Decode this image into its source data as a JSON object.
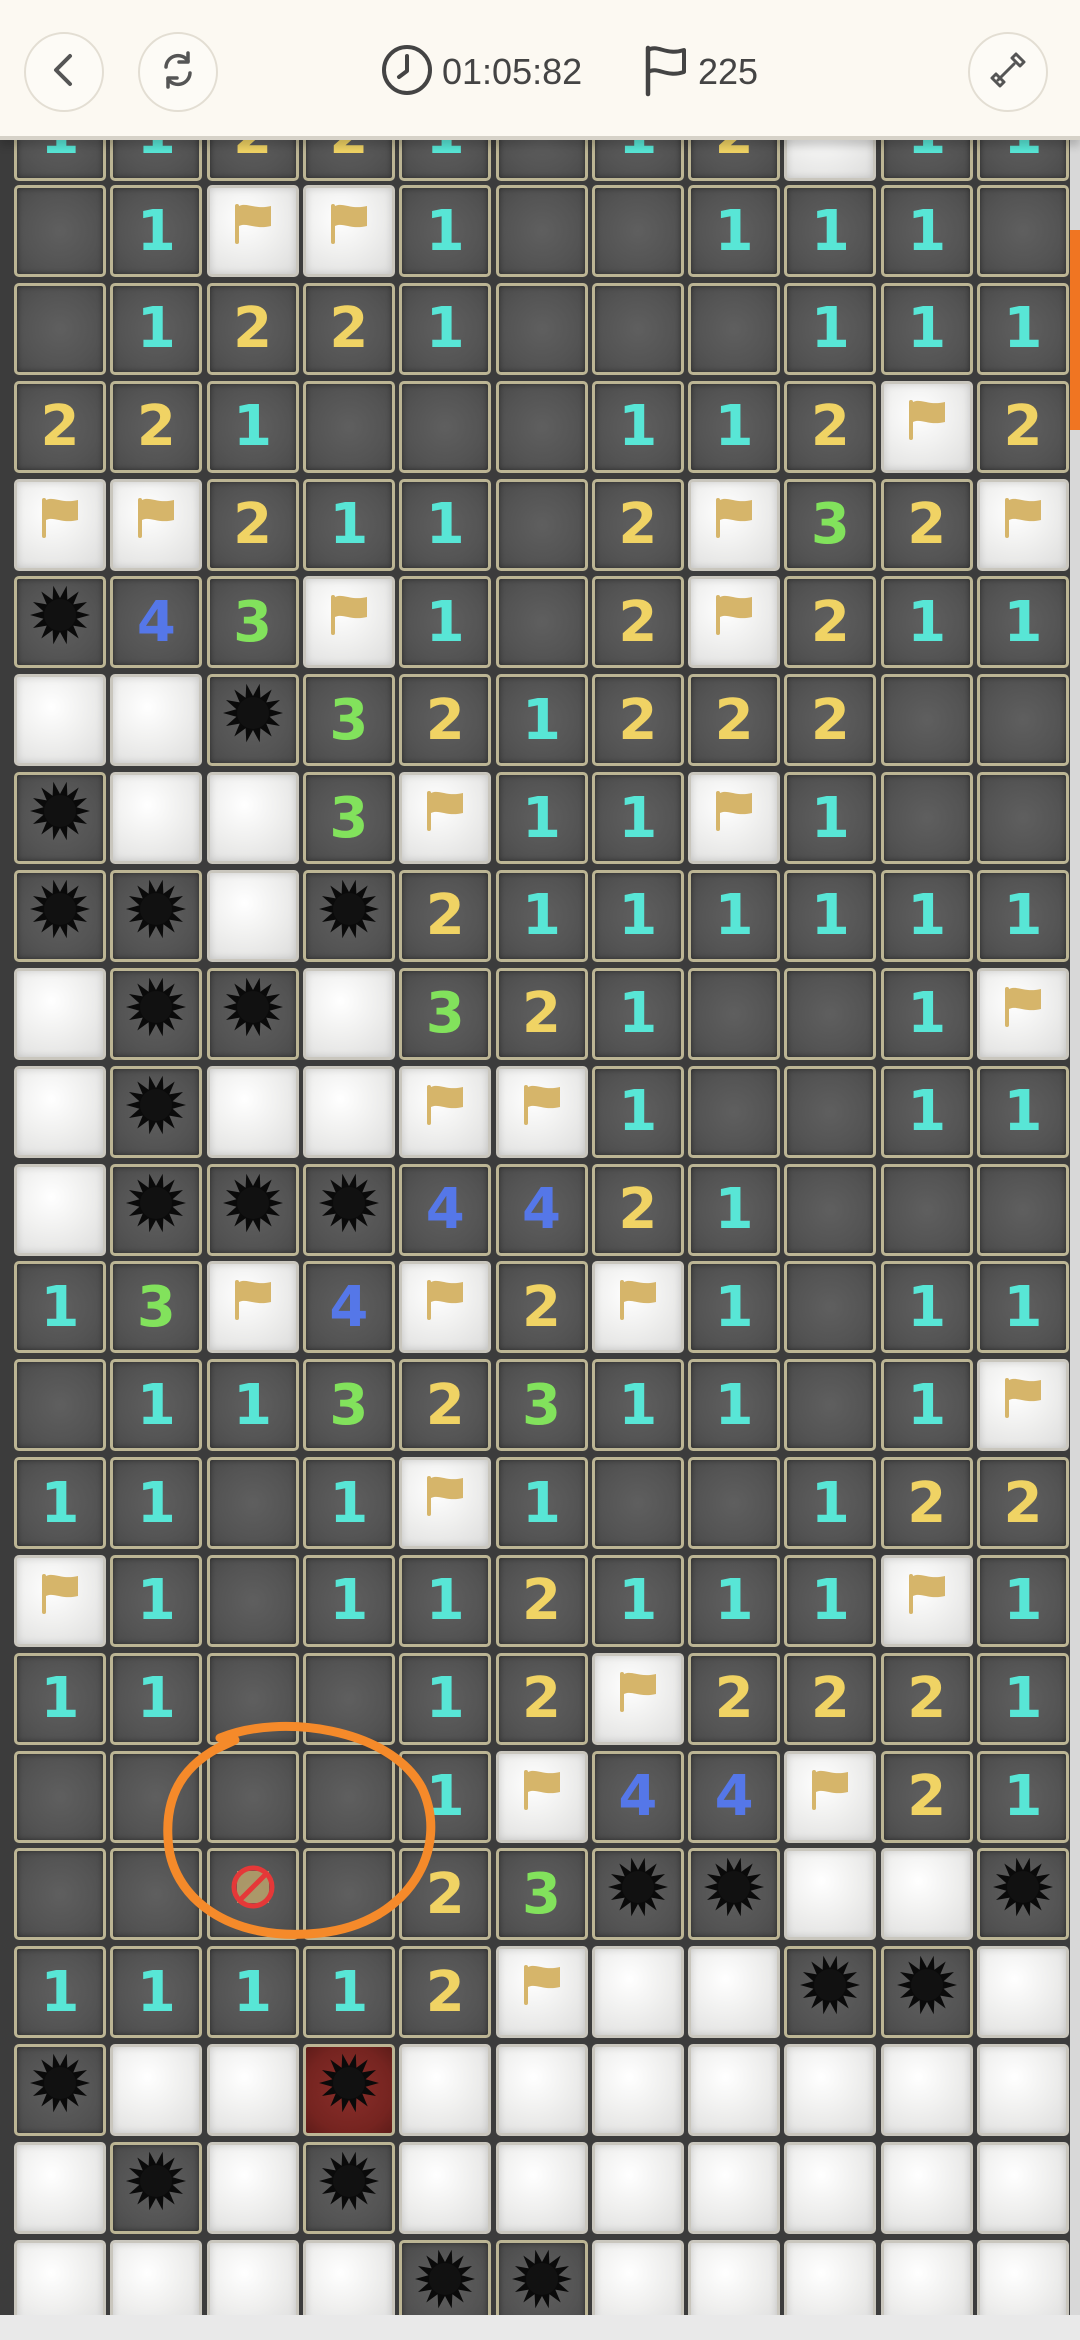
{
  "header": {
    "back_icon": "chevron-left-icon",
    "restart_icon": "restart-icon",
    "timer_icon": "clock-icon",
    "timer": "01:05:82",
    "flag_icon": "flag-icon",
    "flags_count": "225",
    "mode_icon": "shovel-icon"
  },
  "colors": {
    "number_1": "#58e6d6",
    "number_2": "#f0d364",
    "number_3": "#82e25c",
    "number_4": "#5577e8",
    "flag": "#d6b56a",
    "accent_scroll": "#f07522",
    "annotation": "#f58a2a"
  },
  "legend": {
    ".": "revealed-empty",
    "1-4": "revealed-number",
    "F": "flag",
    "H": "hidden",
    "M": "mine",
    "X": "exploded-mine",
    "W": "wrong-flag"
  },
  "board": {
    "columns": 11,
    "top_partial_row": "11221.12H11",
    "rows": [
      ".1FF1..111.",
      ".1221...111",
      "221...112F2",
      "FF211.2F32F",
      "M43F1.2F211",
      "HHM321222..",
      "MHH3F11F1..",
      "MMHM2111111",
      "HMMH321..1F",
      "HMHHFF1..11",
      "HMMM4421...",
      "13F4F2F1.11",
      ".1132311.1F",
      "11.1F1..122",
      "F1.112111F1",
      "11..12F2221",
      "....1F44F21",
      "..W.23MMHHM",
      "11112FHHMMH",
      "MHHXHHHHHHH",
      "HMHMHHHHHHH",
      "HHHHMMHHHHH"
    ]
  }
}
